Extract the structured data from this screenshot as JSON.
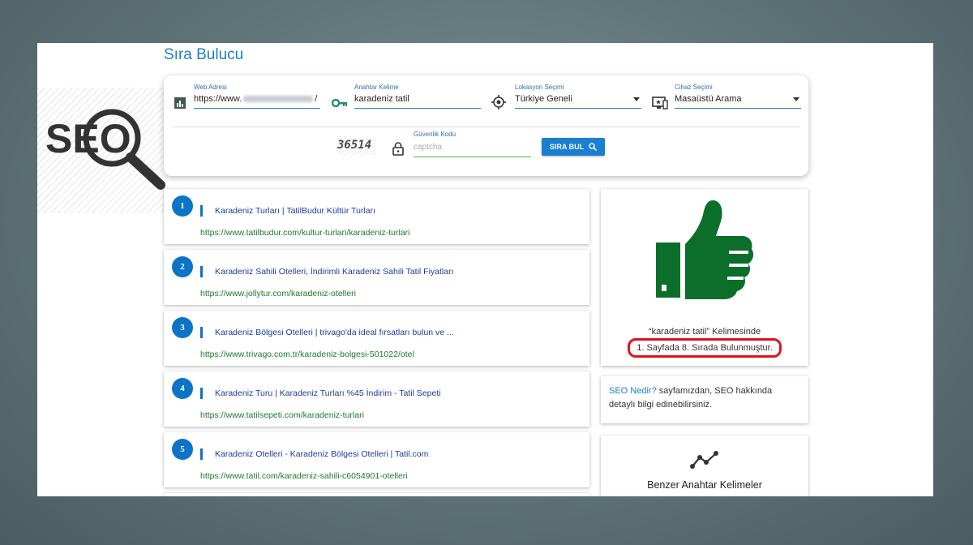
{
  "page": {
    "title": "Sıra Bulucu"
  },
  "logo": {
    "text": "SEO"
  },
  "search": {
    "web": {
      "label": "Web Adresi",
      "value_prefix": "https://www.",
      "value_suffix": "/",
      "icon": "bar-chart-icon"
    },
    "keyword": {
      "label": "Anahtar Kelime",
      "value": "karadeniz tatil",
      "icon": "key-icon"
    },
    "location": {
      "label": "Lokasyon Seçimi",
      "value": "Türkiye Geneli",
      "icon": "crosshair-icon"
    },
    "device": {
      "label": "Cihaz Seçimi",
      "value": "Masaüstü Arama",
      "icon": "device-icon"
    },
    "captcha": {
      "label": "Güvenlik Kodu",
      "placeholder": "captcha",
      "image_text": "36514"
    },
    "button": {
      "label": "SIRA BUL",
      "icon": "search-icon"
    }
  },
  "results": [
    {
      "num": "1",
      "title": "Karadeniz Turları | TatilBudur Kültür Turları",
      "url": "https://www.tatilbudur.com/kultur-turlari/karadeniz-turlari"
    },
    {
      "num": "2",
      "title": "Karadeniz Sahili Otelleri, İndirimli Karadeniz Sahili Tatil Fiyatları",
      "url": "https://www.jollytur.com/karadeniz-otelleri"
    },
    {
      "num": "3",
      "title": "Karadeniz Bölgesi Otelleri | trivago'da ideal fırsatları bulun ve ...",
      "url": "https://www.trivago.com.tr/karadeniz-bolgesi-501022/otel"
    },
    {
      "num": "4",
      "title": "Karadeniz Turu | Karadeniz Turları %45 İndirim - Tatil Sepeti",
      "url": "https://www.tatilsepeti.com/karadeniz-turlari"
    },
    {
      "num": "5",
      "title": "Karadeniz Otelleri - Karadeniz Bölgesi Otelleri | Tatil.com",
      "url": "https://www.tatil.com/karadeniz-sahili-c6054901-otelleri"
    }
  ],
  "rank_result": {
    "line1": "“karadeniz tatil” Kelimesinde",
    "line2": "1. Sayfada 8. Sırada Bulunmuştur.",
    "icon": "thumbs-up-icon",
    "color": "#0b6e2a",
    "highlight_color": "#e0141e"
  },
  "info": {
    "link_text": "SEO Nedir?",
    "text": " sayfamızdan, SEO hakkında detaylı bilgi edinebilirsiniz."
  },
  "similar": {
    "title": "Benzer Anahtar Kelimeler",
    "icon": "trend-line-icon"
  },
  "colors": {
    "accent": "#1a7fd0",
    "title": "#1f7ec5",
    "url_green": "#1d7a2a",
    "result_title": "#1a3e9a"
  }
}
